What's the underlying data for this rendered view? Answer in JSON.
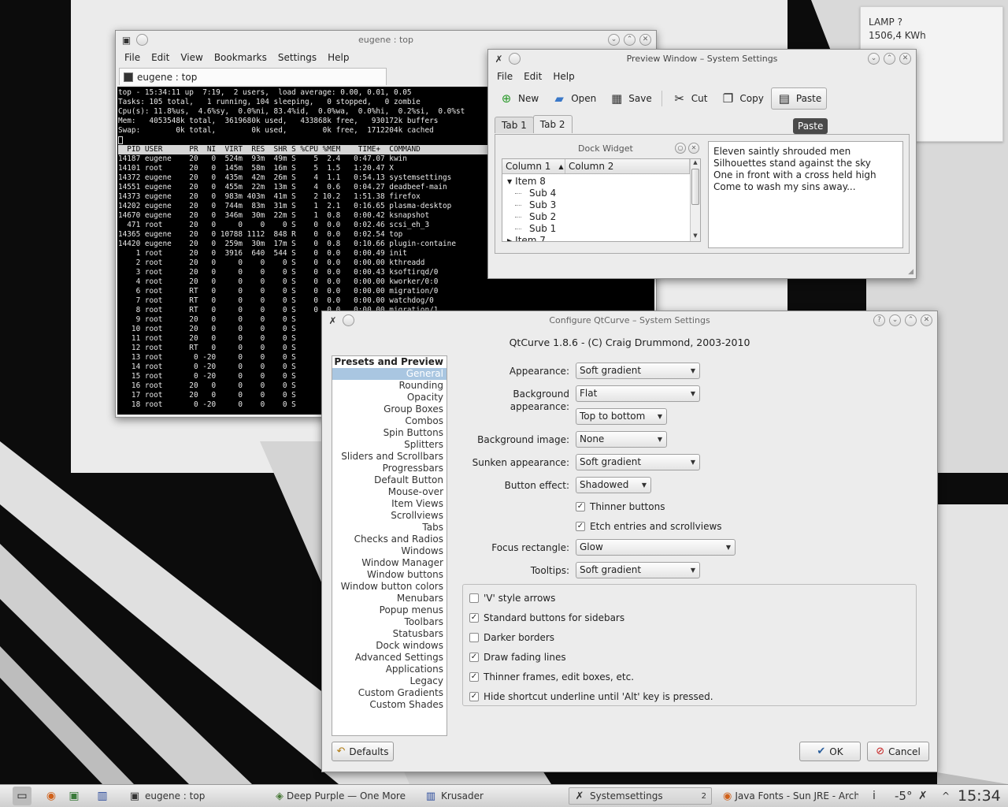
{
  "note": {
    "line1": "LAMP ?",
    "line2": "1506,4 KWh"
  },
  "terminal": {
    "window_title": "eugene : top",
    "menu": [
      "File",
      "Edit",
      "View",
      "Bookmarks",
      "Settings",
      "Help"
    ],
    "tab_label": "eugene : top",
    "lines": [
      "top - 15:34:11 up  7:19,  2 users,  load average: 0.00, 0.01, 0.05",
      "Tasks: 105 total,   1 running, 104 sleeping,   0 stopped,   0 zombie",
      "Cpu(s): 11.8%us,  4.6%sy,  0.0%ni, 83.4%id,  0.0%wa,  0.0%hi,  0.2%si,  0.0%st",
      "Mem:   4053548k total,  3619680k used,   433868k free,   930172k buffers",
      "Swap:        0k total,        0k used,        0k free,  1712204k cached"
    ],
    "header": "  PID USER      PR  NI  VIRT  RES  SHR S %CPU %MEM    TIME+  COMMAND",
    "processes": [
      "14187 eugene    20   0  524m  93m  49m S    5  2.4   0:47.07 kwin",
      "14101 root      20   0  145m  58m  16m S    5  1.5   1:20.47 X",
      "14372 eugene    20   0  435m  42m  26m S    4  1.1   0:54.13 systemsettings",
      "14551 eugene    20   0  455m  22m  13m S    4  0.6   0:04.27 deadbeef-main",
      "14373 eugene    20   0  983m 403m  41m S    2 10.2   1:51.38 firefox",
      "14202 eugene    20   0  744m  83m  31m S    1  2.1   0:16.65 plasma-desktop",
      "14670 eugene    20   0  346m  30m  22m S    1  0.8   0:00.42 ksnapshot",
      "  471 root      20   0     0    0    0 S    0  0.0   0:02.46 scsi_eh_3",
      "14365 eugene    20   0 10788 1112  848 R    0  0.0   0:02.54 top",
      "14420 eugene    20   0  259m  30m  17m S    0  0.8   0:10.66 plugin-containe",
      "    1 root      20   0  3916  640  544 S    0  0.0   0:00.49 init",
      "    2 root      20   0     0    0    0 S    0  0.0   0:00.00 kthreadd",
      "    3 root      20   0     0    0    0 S    0  0.0   0:00.43 ksoftirqd/0",
      "    4 root      20   0     0    0    0 S    0  0.0   0:00.00 kworker/0:0",
      "    6 root      RT   0     0    0    0 S    0  0.0   0:00.00 migration/0",
      "    7 root      RT   0     0    0    0 S    0  0.0   0:00.00 watchdog/0",
      "    8 root      RT   0     0    0    0 S    0  0.0   0:00.00 migration/1",
      "    9 root      20   0     0    0    0 S",
      "   10 root      20   0     0    0    0 S",
      "   11 root      20   0     0    0    0 S",
      "   12 root      RT   0     0    0    0 S",
      "   13 root       0 -20     0    0    0 S",
      "   14 root       0 -20     0    0    0 S",
      "   15 root       0 -20     0    0    0 S",
      "   16 root      20   0     0    0    0 S",
      "   17 root      20   0     0    0    0 S",
      "   18 root       0 -20     0    0    0 S"
    ]
  },
  "preview": {
    "window_title": "Preview Window – System Settings",
    "menu": [
      "File",
      "Edit",
      "Help"
    ],
    "toolbar": {
      "new": "New",
      "open": "Open",
      "save": "Save",
      "cut": "Cut",
      "copy": "Copy",
      "paste": "Paste"
    },
    "tooltip": "Paste",
    "tabs": [
      "Tab 1",
      "Tab 2"
    ],
    "dock_title": "Dock Widget",
    "tree": {
      "columns": [
        "Column 1",
        "Column 2"
      ],
      "rows": [
        {
          "label": "Item 8",
          "level": 0,
          "expanded": true
        },
        {
          "label": "Sub 4",
          "level": 1
        },
        {
          "label": "Sub 3",
          "level": 1
        },
        {
          "label": "Sub 2",
          "level": 1
        },
        {
          "label": "Sub 1",
          "level": 1
        },
        {
          "label": "Item 7",
          "level": 0,
          "expanded": false
        }
      ]
    },
    "text_lines": [
      "Eleven saintly shrouded men",
      "Silhouettes stand against the sky",
      "One in front with a cross held high",
      "Come to wash my sins away..."
    ]
  },
  "config": {
    "window_title": "Configure QtCurve – System Settings",
    "heading": "QtCurve 1.8.6 - (C) Craig Drummond, 2003-2010",
    "sidebar": {
      "section": "Presets and Preview",
      "selected": "General",
      "items": [
        "General",
        "Rounding",
        "Opacity",
        "Group Boxes",
        "Combos",
        "Spin Buttons",
        "Splitters",
        "Sliders and Scrollbars",
        "Progressbars",
        "Default Button",
        "Mouse-over",
        "Item Views",
        "Scrollviews",
        "Tabs",
        "Checks and Radios",
        "Windows",
        "Window Manager",
        "Window buttons",
        "Window button colors",
        "Menubars",
        "Popup menus",
        "Toolbars",
        "Statusbars",
        "Dock windows",
        "Advanced Settings",
        "Applications",
        "Legacy",
        "Custom Gradients",
        "Custom Shades"
      ]
    },
    "form": {
      "appearance_label": "Appearance:",
      "appearance_value": "Soft gradient",
      "bg_appearance_label": "Background appearance:",
      "bg_appearance_value": "Flat",
      "bg_direction_value": "Top to bottom",
      "bg_image_label": "Background image:",
      "bg_image_value": "None",
      "sunken_label": "Sunken appearance:",
      "sunken_value": "Soft gradient",
      "button_effect_label": "Button effect:",
      "button_effect_value": "Shadowed",
      "thinner_buttons": "Thinner buttons",
      "etch_entries": "Etch entries and scrollviews",
      "focus_label": "Focus rectangle:",
      "focus_value": "Glow",
      "tooltips_label": "Tooltips:",
      "tooltips_value": "Soft gradient"
    },
    "options": [
      {
        "label": "'V' style arrows",
        "checked": false
      },
      {
        "label": "Standard buttons for sidebars",
        "checked": true
      },
      {
        "label": "Darker borders",
        "checked": false
      },
      {
        "label": "Draw fading lines",
        "checked": true
      },
      {
        "label": "Thinner frames, edit boxes, etc.",
        "checked": true
      },
      {
        "label": "Hide shortcut underline until 'Alt' key is pressed.",
        "checked": true
      }
    ],
    "buttons": {
      "defaults": "Defaults",
      "ok": "OK",
      "cancel": "Cancel"
    }
  },
  "taskbar": {
    "tasks": [
      "eugene : top",
      "Deep Purple — One More R",
      "Krusader",
      "Systemsettings",
      "Java Fonts - Sun JRE - ArchW"
    ],
    "systemsettings_count": "2",
    "temperature": "-5°",
    "clock": "15:34"
  },
  "colors": {
    "selection": "#a9c6e1",
    "terminal_bg": "#000000",
    "window_bg": "#ececec"
  }
}
